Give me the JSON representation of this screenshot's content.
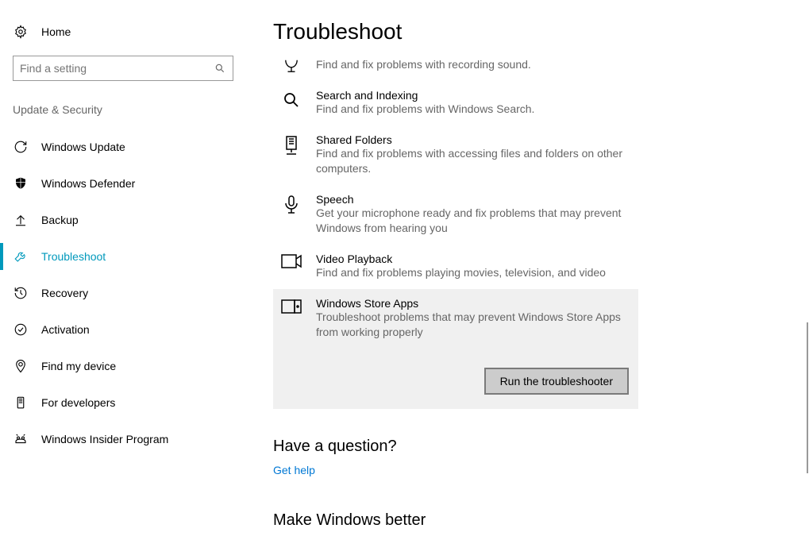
{
  "sidebar": {
    "home_label": "Home",
    "search_placeholder": "Find a setting",
    "category_label": "Update & Security",
    "items": [
      {
        "label": "Windows Update",
        "icon": "sync-icon",
        "selected": false
      },
      {
        "label": "Windows Defender",
        "icon": "shield-icon",
        "selected": false
      },
      {
        "label": "Backup",
        "icon": "backup-icon",
        "selected": false
      },
      {
        "label": "Troubleshoot",
        "icon": "wrench-icon",
        "selected": true
      },
      {
        "label": "Recovery",
        "icon": "history-icon",
        "selected": false
      },
      {
        "label": "Activation",
        "icon": "check-circle-icon",
        "selected": false
      },
      {
        "label": "Find my device",
        "icon": "location-icon",
        "selected": false
      },
      {
        "label": "For developers",
        "icon": "developer-icon",
        "selected": false
      },
      {
        "label": "Windows Insider Program",
        "icon": "insider-icon",
        "selected": false
      }
    ]
  },
  "main": {
    "page_title": "Troubleshoot",
    "items": [
      {
        "title": "",
        "desc": "Find and fix problems with recording sound.",
        "icon": "record-icon",
        "expanded": false,
        "partial": true
      },
      {
        "title": "Search and Indexing",
        "desc": "Find and fix problems with Windows Search.",
        "icon": "search-mag-icon",
        "expanded": false
      },
      {
        "title": "Shared Folders",
        "desc": "Find and fix problems with accessing files and folders on other computers.",
        "icon": "shared-folder-icon",
        "expanded": false
      },
      {
        "title": "Speech",
        "desc": "Get your microphone ready and fix problems that may prevent Windows from hearing you",
        "icon": "mic-icon",
        "expanded": false
      },
      {
        "title": "Video Playback",
        "desc": "Find and fix problems playing movies, television, and video",
        "icon": "video-icon",
        "expanded": false
      },
      {
        "title": "Windows Store Apps",
        "desc": "Troubleshoot problems that may prevent Windows Store Apps from working properly",
        "icon": "store-icon",
        "expanded": true
      }
    ],
    "run_button_label": "Run the troubleshooter",
    "question_heading": "Have a question?",
    "get_help_link": "Get help",
    "improve_heading": "Make Windows better"
  }
}
